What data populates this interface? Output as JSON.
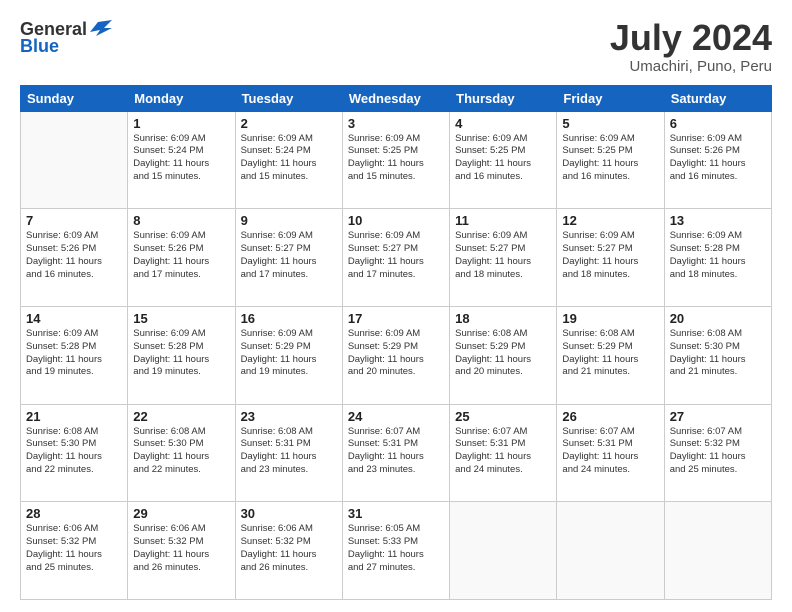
{
  "header": {
    "logo_general": "General",
    "logo_blue": "Blue",
    "month_title": "July 2024",
    "location": "Umachiri, Puno, Peru"
  },
  "calendar": {
    "days_of_week": [
      "Sunday",
      "Monday",
      "Tuesday",
      "Wednesday",
      "Thursday",
      "Friday",
      "Saturday"
    ],
    "weeks": [
      [
        {
          "day": "",
          "info": ""
        },
        {
          "day": "1",
          "info": "Sunrise: 6:09 AM\nSunset: 5:24 PM\nDaylight: 11 hours\nand 15 minutes."
        },
        {
          "day": "2",
          "info": "Sunrise: 6:09 AM\nSunset: 5:24 PM\nDaylight: 11 hours\nand 15 minutes."
        },
        {
          "day": "3",
          "info": "Sunrise: 6:09 AM\nSunset: 5:25 PM\nDaylight: 11 hours\nand 15 minutes."
        },
        {
          "day": "4",
          "info": "Sunrise: 6:09 AM\nSunset: 5:25 PM\nDaylight: 11 hours\nand 16 minutes."
        },
        {
          "day": "5",
          "info": "Sunrise: 6:09 AM\nSunset: 5:25 PM\nDaylight: 11 hours\nand 16 minutes."
        },
        {
          "day": "6",
          "info": "Sunrise: 6:09 AM\nSunset: 5:26 PM\nDaylight: 11 hours\nand 16 minutes."
        }
      ],
      [
        {
          "day": "7",
          "info": "Sunrise: 6:09 AM\nSunset: 5:26 PM\nDaylight: 11 hours\nand 16 minutes."
        },
        {
          "day": "8",
          "info": "Sunrise: 6:09 AM\nSunset: 5:26 PM\nDaylight: 11 hours\nand 17 minutes."
        },
        {
          "day": "9",
          "info": "Sunrise: 6:09 AM\nSunset: 5:27 PM\nDaylight: 11 hours\nand 17 minutes."
        },
        {
          "day": "10",
          "info": "Sunrise: 6:09 AM\nSunset: 5:27 PM\nDaylight: 11 hours\nand 17 minutes."
        },
        {
          "day": "11",
          "info": "Sunrise: 6:09 AM\nSunset: 5:27 PM\nDaylight: 11 hours\nand 18 minutes."
        },
        {
          "day": "12",
          "info": "Sunrise: 6:09 AM\nSunset: 5:27 PM\nDaylight: 11 hours\nand 18 minutes."
        },
        {
          "day": "13",
          "info": "Sunrise: 6:09 AM\nSunset: 5:28 PM\nDaylight: 11 hours\nand 18 minutes."
        }
      ],
      [
        {
          "day": "14",
          "info": "Sunrise: 6:09 AM\nSunset: 5:28 PM\nDaylight: 11 hours\nand 19 minutes."
        },
        {
          "day": "15",
          "info": "Sunrise: 6:09 AM\nSunset: 5:28 PM\nDaylight: 11 hours\nand 19 minutes."
        },
        {
          "day": "16",
          "info": "Sunrise: 6:09 AM\nSunset: 5:29 PM\nDaylight: 11 hours\nand 19 minutes."
        },
        {
          "day": "17",
          "info": "Sunrise: 6:09 AM\nSunset: 5:29 PM\nDaylight: 11 hours\nand 20 minutes."
        },
        {
          "day": "18",
          "info": "Sunrise: 6:08 AM\nSunset: 5:29 PM\nDaylight: 11 hours\nand 20 minutes."
        },
        {
          "day": "19",
          "info": "Sunrise: 6:08 AM\nSunset: 5:29 PM\nDaylight: 11 hours\nand 21 minutes."
        },
        {
          "day": "20",
          "info": "Sunrise: 6:08 AM\nSunset: 5:30 PM\nDaylight: 11 hours\nand 21 minutes."
        }
      ],
      [
        {
          "day": "21",
          "info": "Sunrise: 6:08 AM\nSunset: 5:30 PM\nDaylight: 11 hours\nand 22 minutes."
        },
        {
          "day": "22",
          "info": "Sunrise: 6:08 AM\nSunset: 5:30 PM\nDaylight: 11 hours\nand 22 minutes."
        },
        {
          "day": "23",
          "info": "Sunrise: 6:08 AM\nSunset: 5:31 PM\nDaylight: 11 hours\nand 23 minutes."
        },
        {
          "day": "24",
          "info": "Sunrise: 6:07 AM\nSunset: 5:31 PM\nDaylight: 11 hours\nand 23 minutes."
        },
        {
          "day": "25",
          "info": "Sunrise: 6:07 AM\nSunset: 5:31 PM\nDaylight: 11 hours\nand 24 minutes."
        },
        {
          "day": "26",
          "info": "Sunrise: 6:07 AM\nSunset: 5:31 PM\nDaylight: 11 hours\nand 24 minutes."
        },
        {
          "day": "27",
          "info": "Sunrise: 6:07 AM\nSunset: 5:32 PM\nDaylight: 11 hours\nand 25 minutes."
        }
      ],
      [
        {
          "day": "28",
          "info": "Sunrise: 6:06 AM\nSunset: 5:32 PM\nDaylight: 11 hours\nand 25 minutes."
        },
        {
          "day": "29",
          "info": "Sunrise: 6:06 AM\nSunset: 5:32 PM\nDaylight: 11 hours\nand 26 minutes."
        },
        {
          "day": "30",
          "info": "Sunrise: 6:06 AM\nSunset: 5:32 PM\nDaylight: 11 hours\nand 26 minutes."
        },
        {
          "day": "31",
          "info": "Sunrise: 6:05 AM\nSunset: 5:33 PM\nDaylight: 11 hours\nand 27 minutes."
        },
        {
          "day": "",
          "info": ""
        },
        {
          "day": "",
          "info": ""
        },
        {
          "day": "",
          "info": ""
        }
      ]
    ]
  }
}
